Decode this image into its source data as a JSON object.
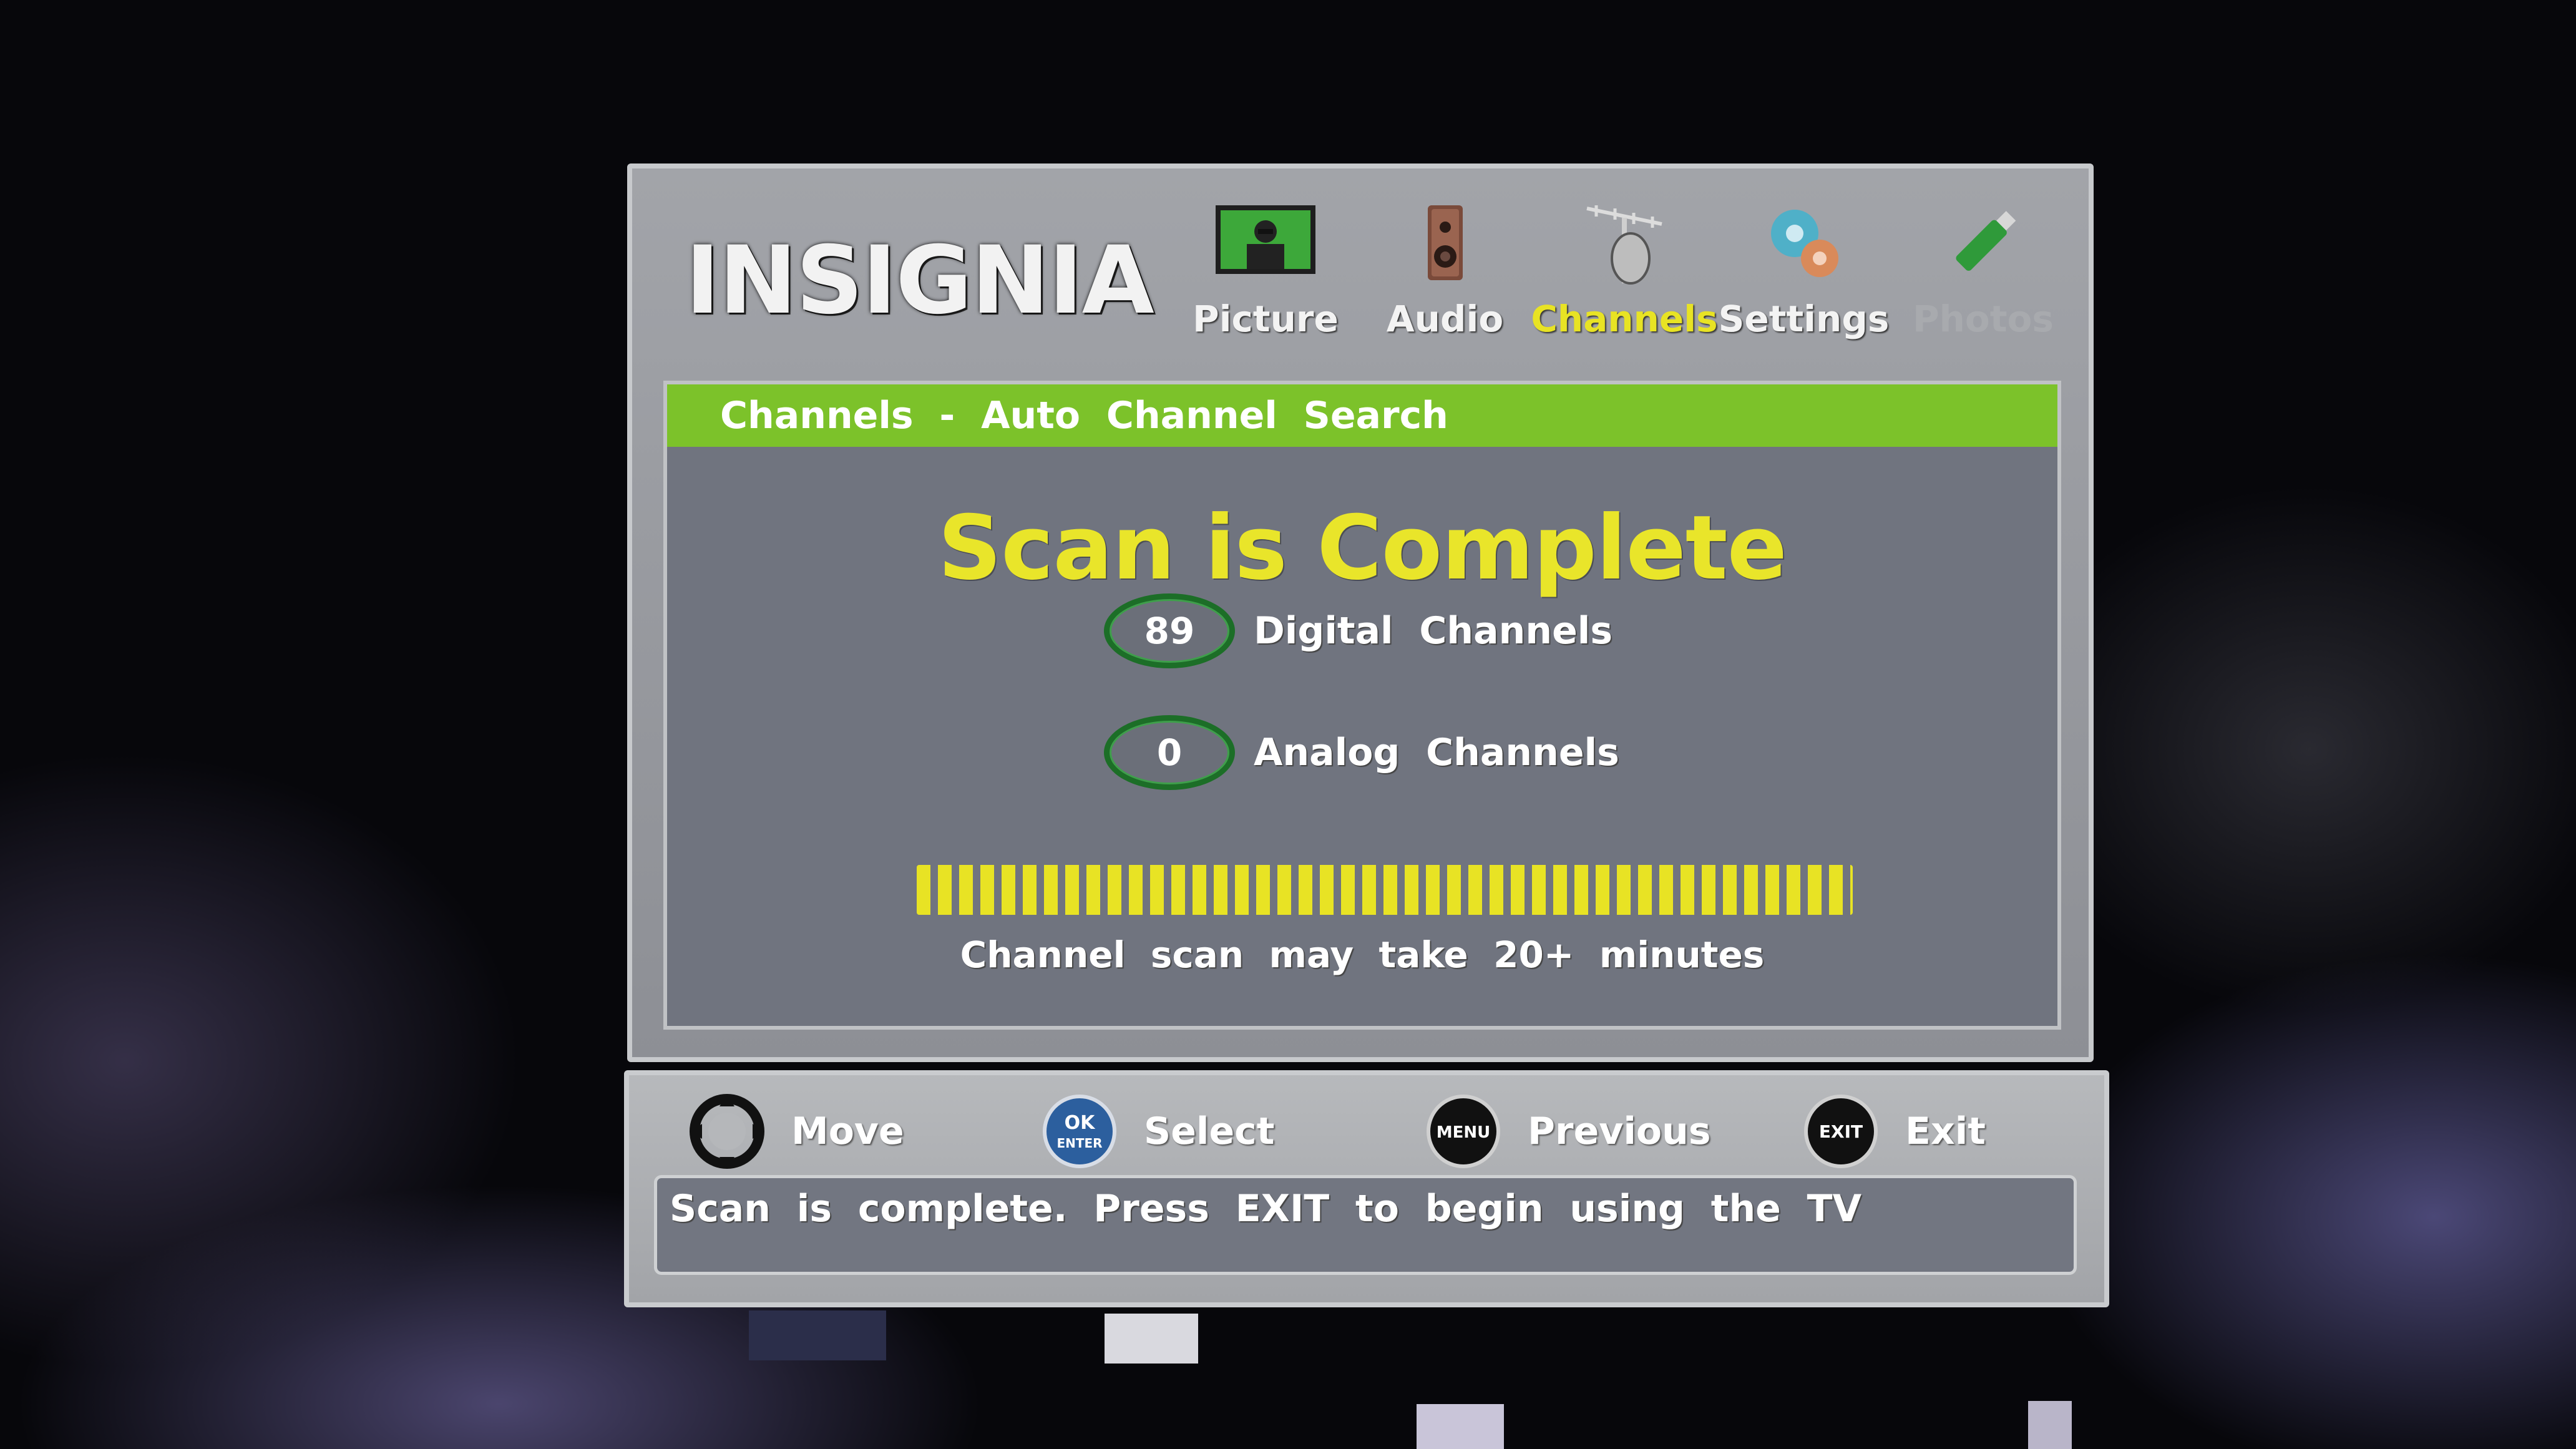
{
  "brand": {
    "logo_text": "INSIGNIA",
    "colors": {
      "accent_green": "#7cc22a",
      "highlight_yellow": "#e8e324"
    }
  },
  "nav": {
    "tabs": [
      {
        "label": "Picture",
        "icon": "picture-icon",
        "state": "normal"
      },
      {
        "label": "Audio",
        "icon": "speaker-icon",
        "state": "normal"
      },
      {
        "label": "Channels",
        "icon": "antenna-icon",
        "state": "selected"
      },
      {
        "label": "Settings",
        "icon": "gears-icon",
        "state": "normal"
      },
      {
        "label": "Photos",
        "icon": "usb-drive-icon",
        "state": "disabled"
      }
    ]
  },
  "panel": {
    "header": "Channels  -  Auto  Channel  Search",
    "title": "Scan is Complete",
    "digital": {
      "count": "89",
      "label": "Digital  Channels"
    },
    "analog": {
      "count": "0",
      "label": "Analog  Channels"
    },
    "progress": 1.0,
    "note": "Channel  scan  may  take  20+  minutes"
  },
  "controls": {
    "move": {
      "label": "Move",
      "icon": "dpad-icon"
    },
    "select": {
      "label": "Select",
      "icon": "ok-enter-icon",
      "icon_text": "OK ENTER"
    },
    "previous": {
      "label": "Previous",
      "icon": "menu-button-icon",
      "icon_text": "MENU"
    },
    "exit": {
      "label": "Exit",
      "icon": "exit-button-icon",
      "icon_text": "EXIT"
    }
  },
  "message": "Scan  is  complete.  Press  EXIT  to  begin  using  the  TV"
}
